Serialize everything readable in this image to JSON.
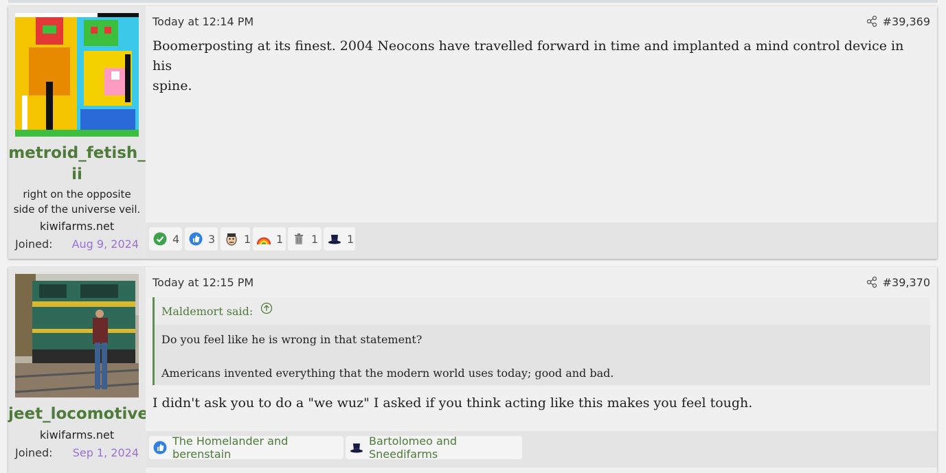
{
  "posts": [
    {
      "username_line1": "metroid_fetish_",
      "username_line2": "ii",
      "user_title_line1": "right on the opposite",
      "user_title_line2": "side of the universe veil.",
      "banner": "kiwifarms.net",
      "joined_label": "Joined:",
      "joined_date": "Aug 9, 2024",
      "timestamp": "Today at 12:14 PM",
      "post_number": "#39,369",
      "body_line1": "Boomerposting at its finest. 2004 Neocons have travelled forward in time and implanted a mind control device in his",
      "body_line2": "spine.",
      "reactions": [
        {
          "icon": "green-check-icon",
          "count": "4"
        },
        {
          "icon": "thumbs-up-icon",
          "count": "3"
        },
        {
          "icon": "face-icon",
          "count": "1"
        },
        {
          "icon": "rainbow-icon",
          "count": "1"
        },
        {
          "icon": "trash-can-icon",
          "count": "1"
        },
        {
          "icon": "top-hat-icon",
          "count": "1"
        }
      ]
    },
    {
      "username": "jeet_locomotive",
      "banner": "kiwifarms.net",
      "joined_label": "Joined:",
      "joined_date": "Sep 1, 2024",
      "timestamp": "Today at 12:15 PM",
      "post_number": "#39,370",
      "quote_author": "Maldemort said:",
      "quote_line1": "Do you feel like he is wrong in that statement?",
      "quote_line2": "Americans invented everything that the modern world uses today; good and bad.",
      "body": "I didn't ask you to do a \"we wuz\" I asked if you think acting like this makes you feel tough.",
      "reaction_lists": [
        {
          "icon": "thumbs-up-icon",
          "names": "The Homelander and berenstain"
        },
        {
          "icon": "top-hat-icon",
          "names": "Bartolomeo and Sneedifarms"
        }
      ]
    }
  ]
}
